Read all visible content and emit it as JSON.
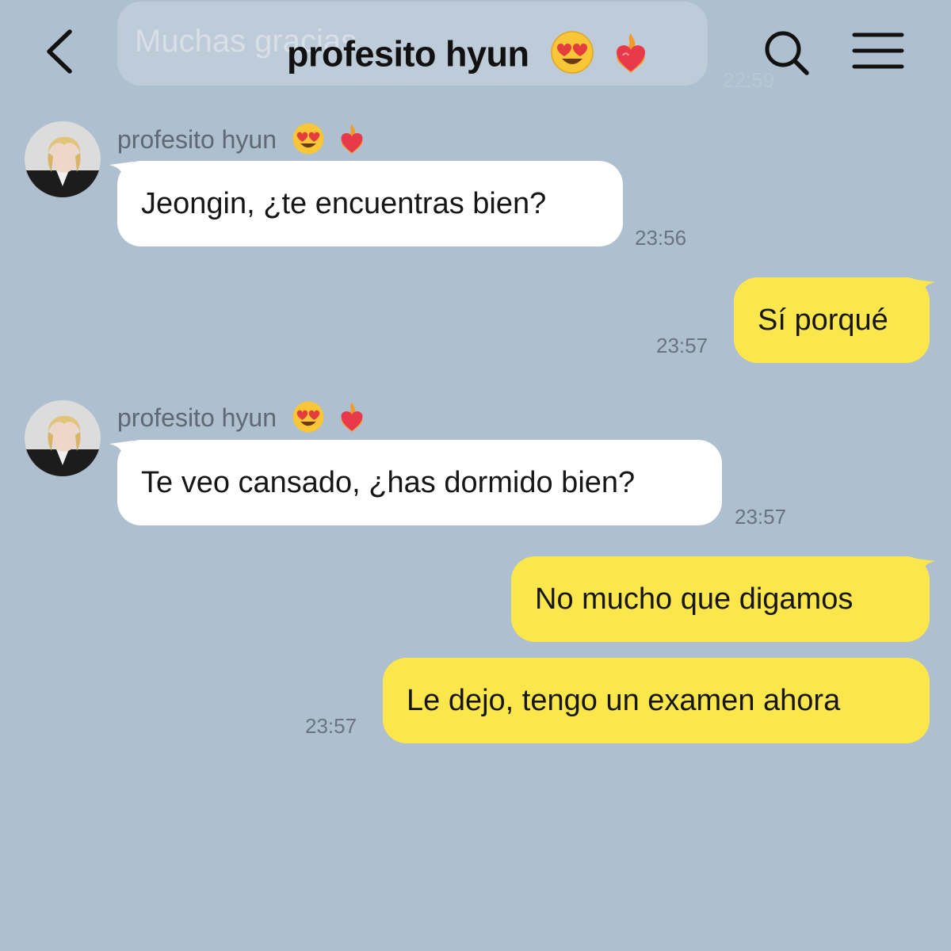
{
  "header": {
    "title": "profesito hyun",
    "title_emojis": [
      "heart-eyes-emoji",
      "burning-heart-emoji"
    ],
    "back_icon": "chevron-left-icon",
    "search_icon": "search-icon",
    "menu_icon": "menu-icon"
  },
  "previous_message": {
    "text_visible_left": "Muchas gracias",
    "time": "22:59"
  },
  "contact": {
    "name": "profesito hyun"
  },
  "messages": [
    {
      "direction": "incoming",
      "text": "Jeongin, ¿te encuentras bien?",
      "time": "23:56"
    },
    {
      "direction": "outgoing",
      "text": "Sí porqué",
      "time": "23:57"
    },
    {
      "direction": "incoming",
      "text": "Te veo cansado, ¿has dormido bien?",
      "time": "23:57"
    },
    {
      "direction": "outgoing",
      "text": "No mucho que digamos",
      "time": ""
    },
    {
      "direction": "outgoing",
      "text": "Le dejo, tengo un examen ahora",
      "time": "23:57"
    }
  ],
  "colors": {
    "background": "#aebfcf",
    "incoming_bubble": "#ffffff",
    "outgoing_bubble": "#fbe64b",
    "timestamp": "#6a7480"
  }
}
